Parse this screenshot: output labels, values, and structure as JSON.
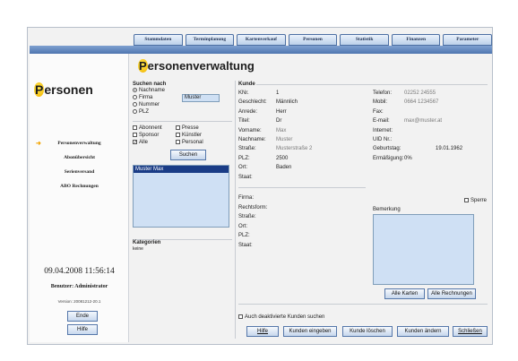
{
  "tabs": [
    "Stammdaten",
    "Terminplanung",
    "Kartenverkauf",
    "Personen",
    "Statistik",
    "Finanzen",
    "Parameter"
  ],
  "left": {
    "title_initial": "P",
    "title_rest": "ersonen",
    "nav": [
      "Personenverwaltung",
      "Abonübersicht",
      "Serienversand",
      "ABO Rechnungen"
    ],
    "active_nav": "Personenverwaltung",
    "datetime": "09.04.2008 11:56:14",
    "user_label": "Benutzer: Administrator",
    "version": "Version: 20081212-20.1",
    "btn_ende": "Ende",
    "btn_hilfe": "Hilfe"
  },
  "main": {
    "title_initial": "P",
    "title_rest": "ersonenverwaltung"
  },
  "search": {
    "heading": "Suchen nach",
    "radios": [
      {
        "label": "Nachname",
        "selected": true
      },
      {
        "label": "Firma",
        "selected": false
      },
      {
        "label": "Nummer",
        "selected": false
      },
      {
        "label": "PLZ",
        "selected": false
      }
    ],
    "field_value": "Muster",
    "checks": [
      {
        "label": "Abonnent",
        "checked": false
      },
      {
        "label": "Presse",
        "checked": false
      },
      {
        "label": "Sponsor",
        "checked": false
      },
      {
        "label": "Künstler",
        "checked": false
      },
      {
        "label": "Alle",
        "checked": true
      },
      {
        "label": "Personal",
        "checked": false
      }
    ],
    "button": "Suchen",
    "results": [
      "Muster Max"
    ]
  },
  "categories": {
    "heading": "Kategorien",
    "value": "keine"
  },
  "customer": {
    "heading": "Kunde",
    "left_fields": [
      {
        "label": "KNr.",
        "value": "1"
      },
      {
        "label": "Geschlecht:",
        "value": "Männlich"
      },
      {
        "label": "Anrede:",
        "value": "Herr"
      },
      {
        "label": "Titel:",
        "value": "Dr"
      },
      {
        "label": "Vorname:",
        "value": "Max"
      },
      {
        "label": "Nachname:",
        "value": "Muster"
      },
      {
        "label": "Straße:",
        "value": "Musterstraße 2"
      },
      {
        "label": "PLZ:",
        "value": "2500"
      },
      {
        "label": "Ort:",
        "value": "Baden"
      },
      {
        "label": "Staat:",
        "value": ""
      }
    ],
    "company_fields": [
      "Firma:",
      "Rechtsform:",
      "Straße:",
      "Ort:",
      "PLZ:",
      "Staat:"
    ],
    "right_fields": [
      {
        "label": "Telefon:",
        "value": "02252 24555"
      },
      {
        "label": "Mobil:",
        "value": "0664 1234567"
      },
      {
        "label": "Fax:",
        "value": ""
      },
      {
        "label": "E-mail:",
        "value": "max@muster.at"
      },
      {
        "label": "Internet:",
        "value": ""
      },
      {
        "label": "UID Nr.:",
        "value": ""
      },
      {
        "label": "Geburtstag:",
        "value": "19.01.1962"
      },
      {
        "label": "Ermäßigung:",
        "value": "0%"
      }
    ],
    "sperre_label": "Sperre",
    "bemerkung_label": "Bemerkung",
    "btn_alle_karten": "Alle Karten",
    "btn_alle_rechnungen": "Alle Rechnungen",
    "deactivated_label": "Auch deaktivierte Kunden suchen"
  },
  "bottom_buttons": [
    "Hilfe",
    "Kunden eingeben",
    "Kunde löschen",
    "Kunden ändern",
    "Schließen"
  ]
}
